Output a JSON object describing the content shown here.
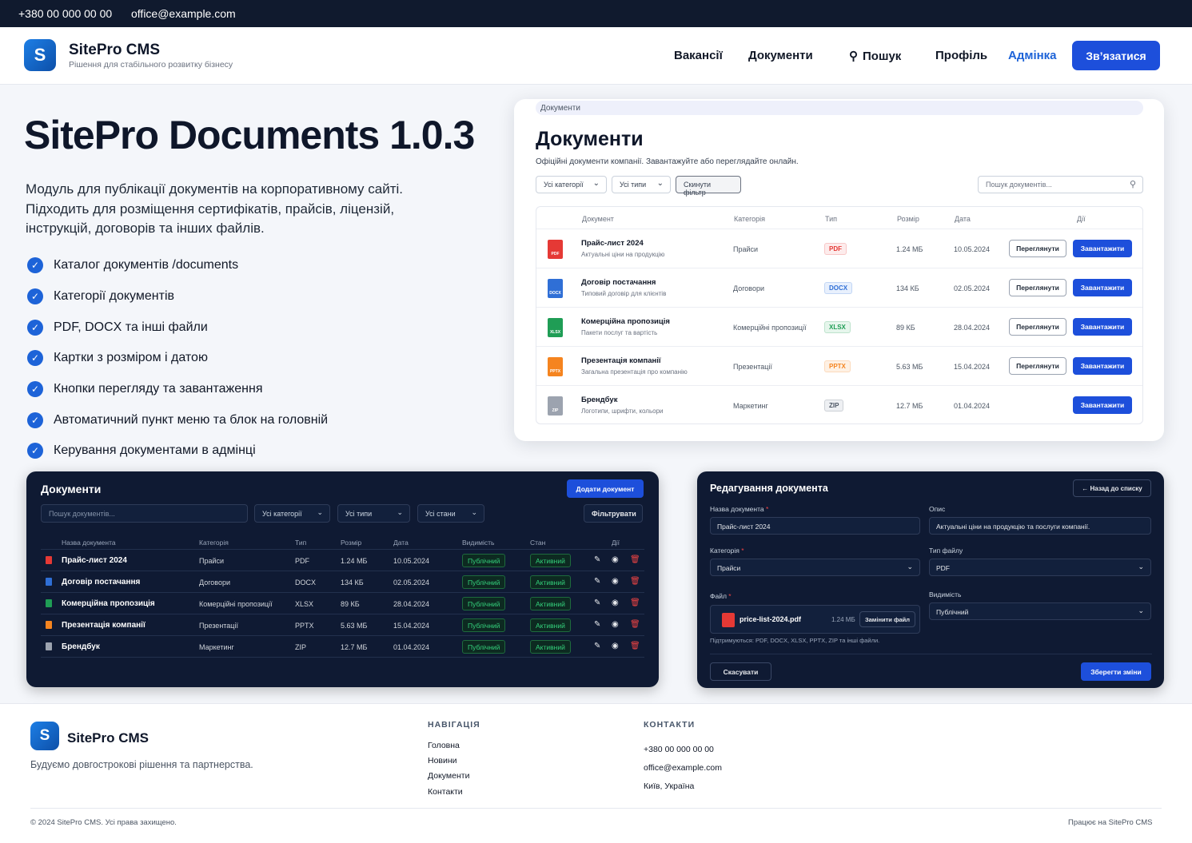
{
  "topbar": {
    "phone": "+380 00 000 00 00",
    "email": "office@example.com"
  },
  "header": {
    "logo_letter": "S",
    "brand": "SitePro CMS",
    "tagline": "Рішення для стабільного розвитку бізнесу",
    "nav": {
      "vacancies": "Вакансії",
      "documents": "Документи",
      "search": "Пошук",
      "profile": "Профіль",
      "admin": "Адмінка"
    },
    "cta": "Зв’язатися"
  },
  "hero": {
    "title": "SitePro Documents 1.0.3",
    "lead_lines": [
      "Модуль для публікації документів на корпоративному сайті.",
      "Підходить для розміщення сертифікатів, прайсів, ліцензій,",
      "інструкцій, договорів та інших файлів."
    ],
    "features": [
      "Каталог документів /documents",
      "Категорії документів",
      "PDF, DOCX та інші файли",
      "Картки з розміром і датою",
      "Кнопки перегляду та завантаження",
      "Автоматичний пункт меню та блок на головній",
      "Керування документами в адмінці"
    ]
  },
  "public_panel": {
    "breadcrumb": "Документи",
    "title": "Документи",
    "subtitle": "Офіційні документи компанії. Завантажуйте або переглядайте онлайн.",
    "filter_category": "Усі категорії",
    "filter_type": "Усі типи",
    "reset": "Скинути фільтр",
    "search_placeholder": "Пошук документів...",
    "columns": {
      "doc": "Документ",
      "category": "Категорія",
      "type": "Тип",
      "size": "Розмір",
      "date": "Дата",
      "actions": "Дії"
    },
    "view_label": "Переглянути",
    "download_label": "Завантажити",
    "rows": [
      {
        "name": "Прайс-лист 2024",
        "desc": "Актуальні ціни на продукцію",
        "category": "Прайси",
        "type": "PDF",
        "size": "1.24 МБ",
        "date": "10.05.2024",
        "icon": "PDF",
        "color": "#e53935"
      },
      {
        "name": "Договір постачання",
        "desc": "Типовий договір для клієнтів",
        "category": "Договори",
        "type": "DOCX",
        "size": "134 КБ",
        "date": "02.05.2024",
        "icon": "DOCX",
        "color": "#2f6fd6"
      },
      {
        "name": "Комерційна пропозиція",
        "desc": "Пакети послуг та вартість",
        "category": "Комерційні пропозиції",
        "type": "XLSX",
        "size": "89 КБ",
        "date": "28.04.2024",
        "icon": "XLSX",
        "color": "#1f9d55"
      },
      {
        "name": "Презентація компанії",
        "desc": "Загальна презентація про компанію",
        "category": "Презентації",
        "type": "PPTX",
        "size": "5.63 МБ",
        "date": "15.04.2024",
        "icon": "PPTX",
        "color": "#f5841f"
      },
      {
        "name": "Брендбук",
        "desc": "Логотипи, шрифти, кольори",
        "category": "Маркетинг",
        "type": "ZIP",
        "size": "12.7 МБ",
        "date": "01.04.2024",
        "icon": "ZIP",
        "color": "#9ca3af"
      }
    ]
  },
  "admin_list": {
    "title": "Документи",
    "add_button": "Додати документ",
    "search_placeholder": "Пошук документів...",
    "filter_category": "Усі категорії",
    "filter_type": "Усі типи",
    "filter_status": "Усі стани",
    "filter_button": "Фільтрувати",
    "columns": {
      "name": "Назва документа",
      "category": "Категорія",
      "type": "Тип",
      "size": "Розмір",
      "date": "Дата",
      "visibility": "Видимість",
      "status": "Стан",
      "actions": "Дії"
    },
    "visibility_label": "Публічний",
    "status_label": "Активний",
    "rows": [
      {
        "name": "Прайс-лист 2024",
        "category": "Прайси",
        "type": "PDF",
        "size": "1.24 МБ",
        "date": "10.05.2024",
        "color": "#e53935"
      },
      {
        "name": "Договір постачання",
        "category": "Договори",
        "type": "DOCX",
        "size": "134 КБ",
        "date": "02.05.2024",
        "color": "#2f6fd6"
      },
      {
        "name": "Комерційна пропозиція",
        "category": "Комерційні пропозиції",
        "type": "XLSX",
        "size": "89 КБ",
        "date": "28.04.2024",
        "color": "#1f9d55"
      },
      {
        "name": "Презентація компанії",
        "category": "Презентації",
        "type": "PPTX",
        "size": "5.63 МБ",
        "date": "15.04.2024",
        "color": "#f5841f"
      },
      {
        "name": "Брендбук",
        "category": "Маркетинг",
        "type": "ZIP",
        "size": "12.7 МБ",
        "date": "01.04.2024",
        "color": "#9ca3af"
      }
    ]
  },
  "edit_panel": {
    "title": "Редагування документа",
    "back": "← Назад до списку",
    "name_label": "Назва документа",
    "name_value": "Прайс-лист 2024",
    "desc_label": "Опис",
    "desc_value": "Актуальні ціни на продукцію та послуги компанії.",
    "category_label": "Категорія",
    "category_value": "Прайси",
    "filetype_label": "Тип файлу",
    "filetype_value": "PDF",
    "file_label": "Файл",
    "file_name": "price-list-2024.pdf",
    "file_size": "1.24 МБ",
    "replace": "Замінити файл",
    "hint": "Підтримуються: PDF, DOCX, XLSX, PPTX, ZIP та інші файли.",
    "visibility_label": "Видимість",
    "visibility_value": "Публічний",
    "cancel": "Скасувати",
    "save": "Зберегти зміни"
  },
  "footer": {
    "brand": "SitePro CMS",
    "tagline": "Будуємо довгострокові рішення та партнерства.",
    "nav_title": "НАВІГАЦІЯ",
    "nav": [
      "Головна",
      "Новини",
      "Документи",
      "Контакти"
    ],
    "contacts_title": "КОНТАКТИ",
    "contacts": [
      "+380 00 000 00 00",
      "office@example.com",
      "Київ, Україна"
    ],
    "copyright": "© 2024 SitePro CMS. Усі права захищено.",
    "powered": "Працює на SitePro CMS"
  },
  "colors": {
    "accent": "#1d4fdb",
    "dark_bg": "#0f1a33",
    "topbar": "#101a2e",
    "admin_link": "#1d63d8"
  }
}
